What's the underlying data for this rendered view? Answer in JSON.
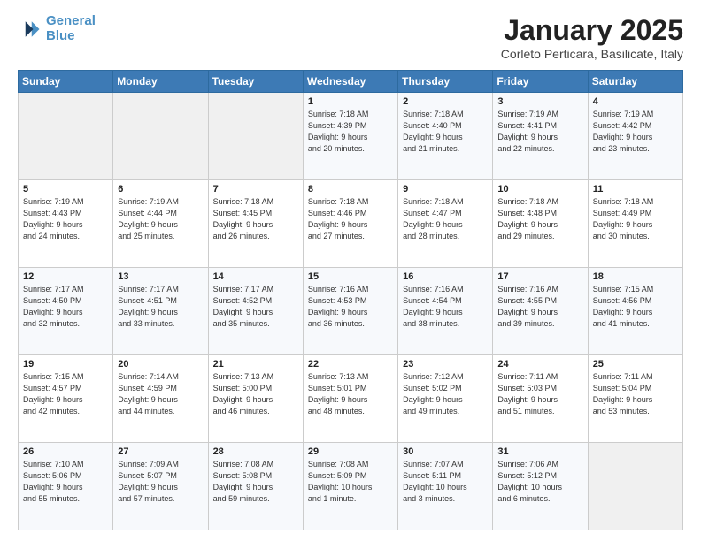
{
  "header": {
    "logo_line1": "General",
    "logo_line2": "Blue",
    "title": "January 2025",
    "subtitle": "Corleto Perticara, Basilicate, Italy"
  },
  "days_of_week": [
    "Sunday",
    "Monday",
    "Tuesday",
    "Wednesday",
    "Thursday",
    "Friday",
    "Saturday"
  ],
  "weeks": [
    [
      {
        "day": "",
        "info": ""
      },
      {
        "day": "",
        "info": ""
      },
      {
        "day": "",
        "info": ""
      },
      {
        "day": "1",
        "info": "Sunrise: 7:18 AM\nSunset: 4:39 PM\nDaylight: 9 hours\nand 20 minutes."
      },
      {
        "day": "2",
        "info": "Sunrise: 7:18 AM\nSunset: 4:40 PM\nDaylight: 9 hours\nand 21 minutes."
      },
      {
        "day": "3",
        "info": "Sunrise: 7:19 AM\nSunset: 4:41 PM\nDaylight: 9 hours\nand 22 minutes."
      },
      {
        "day": "4",
        "info": "Sunrise: 7:19 AM\nSunset: 4:42 PM\nDaylight: 9 hours\nand 23 minutes."
      }
    ],
    [
      {
        "day": "5",
        "info": "Sunrise: 7:19 AM\nSunset: 4:43 PM\nDaylight: 9 hours\nand 24 minutes."
      },
      {
        "day": "6",
        "info": "Sunrise: 7:19 AM\nSunset: 4:44 PM\nDaylight: 9 hours\nand 25 minutes."
      },
      {
        "day": "7",
        "info": "Sunrise: 7:18 AM\nSunset: 4:45 PM\nDaylight: 9 hours\nand 26 minutes."
      },
      {
        "day": "8",
        "info": "Sunrise: 7:18 AM\nSunset: 4:46 PM\nDaylight: 9 hours\nand 27 minutes."
      },
      {
        "day": "9",
        "info": "Sunrise: 7:18 AM\nSunset: 4:47 PM\nDaylight: 9 hours\nand 28 minutes."
      },
      {
        "day": "10",
        "info": "Sunrise: 7:18 AM\nSunset: 4:48 PM\nDaylight: 9 hours\nand 29 minutes."
      },
      {
        "day": "11",
        "info": "Sunrise: 7:18 AM\nSunset: 4:49 PM\nDaylight: 9 hours\nand 30 minutes."
      }
    ],
    [
      {
        "day": "12",
        "info": "Sunrise: 7:17 AM\nSunset: 4:50 PM\nDaylight: 9 hours\nand 32 minutes."
      },
      {
        "day": "13",
        "info": "Sunrise: 7:17 AM\nSunset: 4:51 PM\nDaylight: 9 hours\nand 33 minutes."
      },
      {
        "day": "14",
        "info": "Sunrise: 7:17 AM\nSunset: 4:52 PM\nDaylight: 9 hours\nand 35 minutes."
      },
      {
        "day": "15",
        "info": "Sunrise: 7:16 AM\nSunset: 4:53 PM\nDaylight: 9 hours\nand 36 minutes."
      },
      {
        "day": "16",
        "info": "Sunrise: 7:16 AM\nSunset: 4:54 PM\nDaylight: 9 hours\nand 38 minutes."
      },
      {
        "day": "17",
        "info": "Sunrise: 7:16 AM\nSunset: 4:55 PM\nDaylight: 9 hours\nand 39 minutes."
      },
      {
        "day": "18",
        "info": "Sunrise: 7:15 AM\nSunset: 4:56 PM\nDaylight: 9 hours\nand 41 minutes."
      }
    ],
    [
      {
        "day": "19",
        "info": "Sunrise: 7:15 AM\nSunset: 4:57 PM\nDaylight: 9 hours\nand 42 minutes."
      },
      {
        "day": "20",
        "info": "Sunrise: 7:14 AM\nSunset: 4:59 PM\nDaylight: 9 hours\nand 44 minutes."
      },
      {
        "day": "21",
        "info": "Sunrise: 7:13 AM\nSunset: 5:00 PM\nDaylight: 9 hours\nand 46 minutes."
      },
      {
        "day": "22",
        "info": "Sunrise: 7:13 AM\nSunset: 5:01 PM\nDaylight: 9 hours\nand 48 minutes."
      },
      {
        "day": "23",
        "info": "Sunrise: 7:12 AM\nSunset: 5:02 PM\nDaylight: 9 hours\nand 49 minutes."
      },
      {
        "day": "24",
        "info": "Sunrise: 7:11 AM\nSunset: 5:03 PM\nDaylight: 9 hours\nand 51 minutes."
      },
      {
        "day": "25",
        "info": "Sunrise: 7:11 AM\nSunset: 5:04 PM\nDaylight: 9 hours\nand 53 minutes."
      }
    ],
    [
      {
        "day": "26",
        "info": "Sunrise: 7:10 AM\nSunset: 5:06 PM\nDaylight: 9 hours\nand 55 minutes."
      },
      {
        "day": "27",
        "info": "Sunrise: 7:09 AM\nSunset: 5:07 PM\nDaylight: 9 hours\nand 57 minutes."
      },
      {
        "day": "28",
        "info": "Sunrise: 7:08 AM\nSunset: 5:08 PM\nDaylight: 9 hours\nand 59 minutes."
      },
      {
        "day": "29",
        "info": "Sunrise: 7:08 AM\nSunset: 5:09 PM\nDaylight: 10 hours\nand 1 minute."
      },
      {
        "day": "30",
        "info": "Sunrise: 7:07 AM\nSunset: 5:11 PM\nDaylight: 10 hours\nand 3 minutes."
      },
      {
        "day": "31",
        "info": "Sunrise: 7:06 AM\nSunset: 5:12 PM\nDaylight: 10 hours\nand 6 minutes."
      },
      {
        "day": "",
        "info": ""
      }
    ]
  ]
}
